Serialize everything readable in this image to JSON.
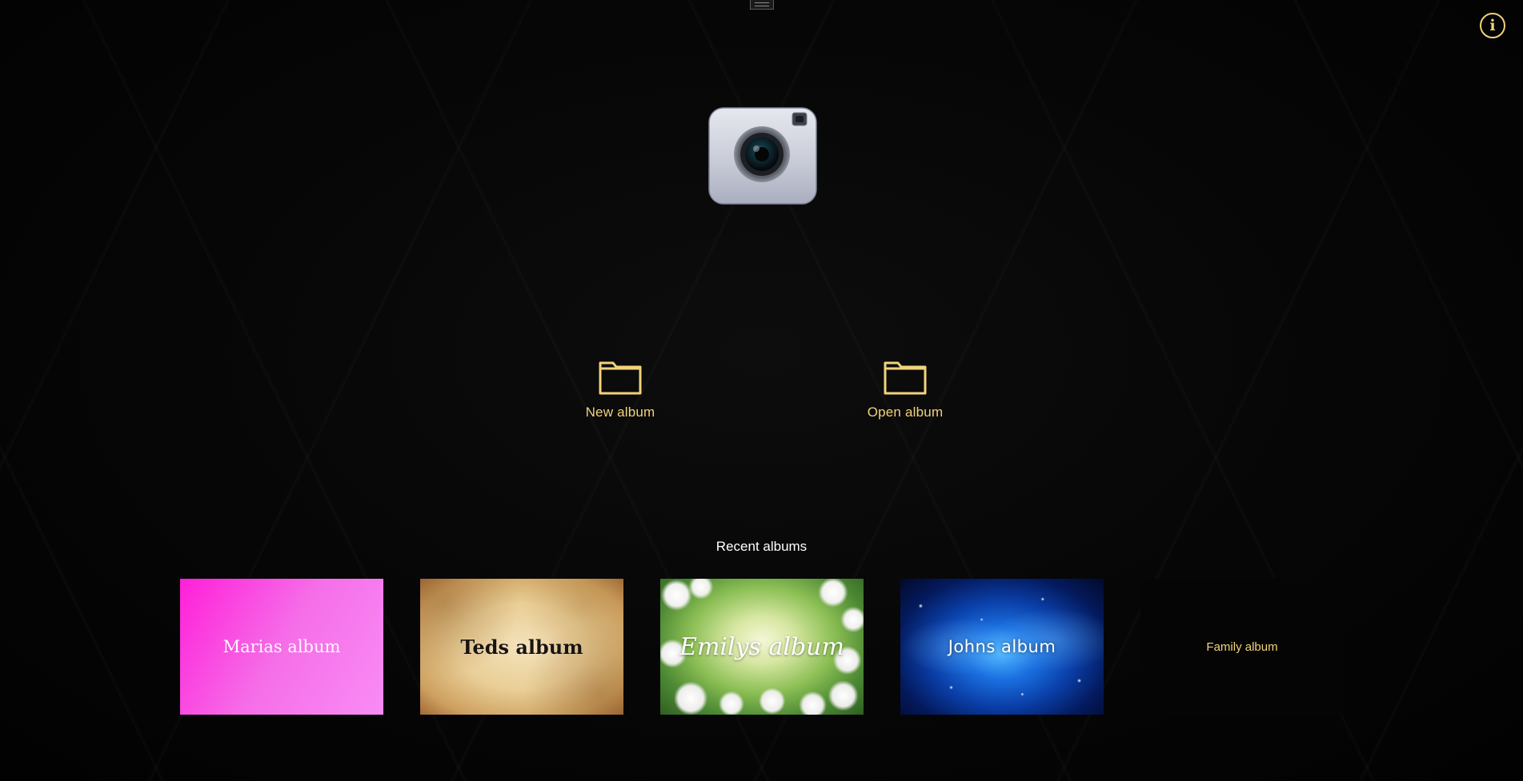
{
  "accent_color": "#f2d27a",
  "top_handle": {
    "icon": "menu-handle-icon"
  },
  "info": {
    "icon": "info-icon",
    "glyph": "i"
  },
  "logo": {
    "icon": "camera-icon"
  },
  "actions": {
    "new_album": {
      "icon": "folder-icon",
      "label": "New album"
    },
    "open_album": {
      "icon": "folder-icon",
      "label": "Open album"
    }
  },
  "recent": {
    "title": "Recent albums",
    "albums": [
      {
        "title": "Marias album"
      },
      {
        "title": "Teds album"
      },
      {
        "title": "Emilys album"
      },
      {
        "title": "Johns album"
      },
      {
        "title": "Family album"
      }
    ]
  }
}
